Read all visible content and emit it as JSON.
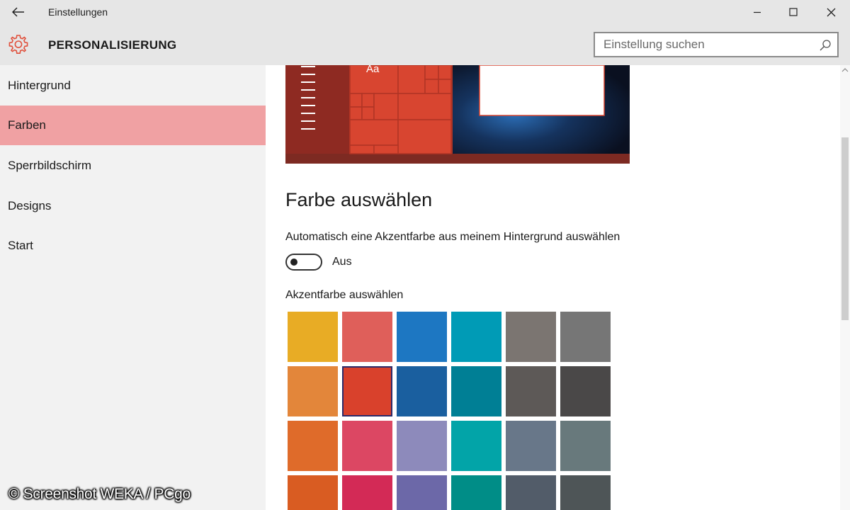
{
  "window": {
    "title": "Einstellungen",
    "controls": [
      "minimize",
      "maximize",
      "close"
    ]
  },
  "header": {
    "section_title": "PERSONALISIERUNG",
    "icon": "gear-icon",
    "accent_color": "#e0503c",
    "search": {
      "value": "",
      "placeholder": "Einstellung suchen"
    }
  },
  "sidebar": {
    "active_index": 1,
    "active_color": "#f0a1a3",
    "items": [
      {
        "label": "Hintergrund"
      },
      {
        "label": "Farben"
      },
      {
        "label": "Sperrbildschirm"
      },
      {
        "label": "Designs"
      },
      {
        "label": "Start"
      }
    ]
  },
  "preview": {
    "sample_text": "Aa",
    "accent_color": "#d84530"
  },
  "main": {
    "heading": "Farbe auswählen",
    "auto_accent_label": "Automatisch eine Akzentfarbe aus meinem Hintergrund auswählen",
    "toggle": {
      "on": false,
      "state_label": "Aus"
    },
    "accent_label": "Akzentfarbe auswählen",
    "selected_swatch": {
      "row": 1,
      "col": 1
    },
    "swatches": [
      [
        "#e8ac25",
        "#df5f5a",
        "#1d77c2",
        "#009bb6",
        "#7b7571",
        "#767676"
      ],
      [
        "#e3863a",
        "#d9412c",
        "#1a5f9f",
        "#007f95",
        "#5d5957",
        "#4a4848"
      ],
      [
        "#df6b2a",
        "#dc4763",
        "#8d8abb",
        "#02a4a8",
        "#687789",
        "#68797c"
      ],
      [
        "#d95c22",
        "#d32a56",
        "#6c68a8",
        "#008d87",
        "#525c69",
        "#4e5557"
      ]
    ]
  },
  "watermark": "© Screenshot WEKA / PCgo"
}
